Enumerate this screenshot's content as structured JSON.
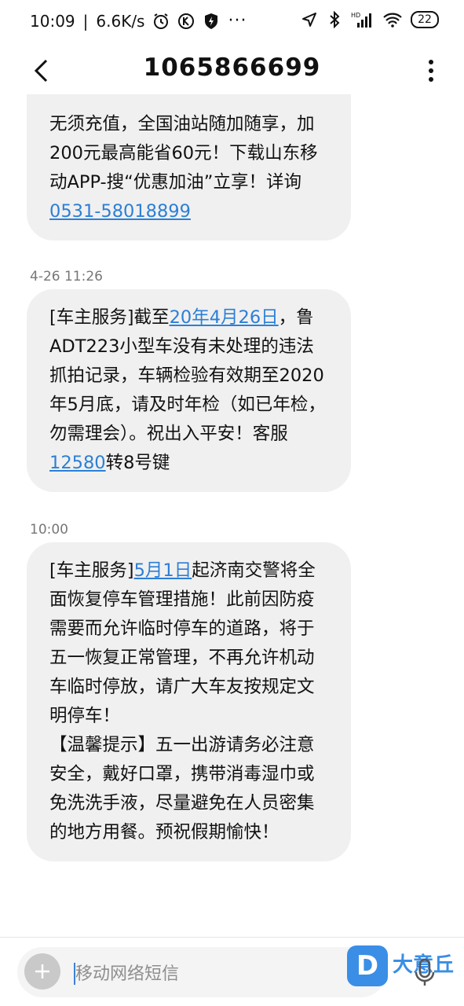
{
  "status_bar": {
    "time": "10:09",
    "speed": "6.6K/s",
    "battery": "22",
    "hd_label": "HD"
  },
  "header": {
    "title": "1065866699"
  },
  "messages": [
    {
      "parts": [
        {
          "text": "无须充值，全国油站随加随享，加200元最高能省60元！下载山东移动APP-搜“优惠加油”立享！详询",
          "link": false
        },
        {
          "text": "0531-58018899",
          "link": true
        }
      ]
    },
    {
      "timestamp": "4-26 11:26",
      "parts": [
        {
          "text": "[车主服务]截至",
          "link": false
        },
        {
          "text": "20年4月26日",
          "link": true
        },
        {
          "text": "，鲁ADT223小型车没有未处理的违法抓拍记录，车辆检验有效期至2020年5月底，请及时年检（如已年检，勿需理会）。祝出入平安！客服",
          "link": false
        },
        {
          "text": "12580",
          "link": true
        },
        {
          "text": "转8号键",
          "link": false
        }
      ]
    },
    {
      "timestamp": "10:00",
      "parts": [
        {
          "text": "[车主服务]",
          "link": false
        },
        {
          "text": "5月1日",
          "link": true
        },
        {
          "text": "起济南交警将全面恢复停车管理措施！此前因防疫需要而允许临时停车的道路，将于五一恢复正常管理，不再允许机动车临时停放，请广大车友按规定文明停车！\n【温馨提示】五一出游请务必注意安全，戴好口罩，携带消毒湿巾或免洗洗手液，尽量避免在人员密集的地方用餐。预祝假期愉快！",
          "link": false
        }
      ]
    }
  ],
  "input": {
    "placeholder": "移动网络短信"
  },
  "watermark": {
    "badge": "D",
    "text": "大意丘"
  }
}
